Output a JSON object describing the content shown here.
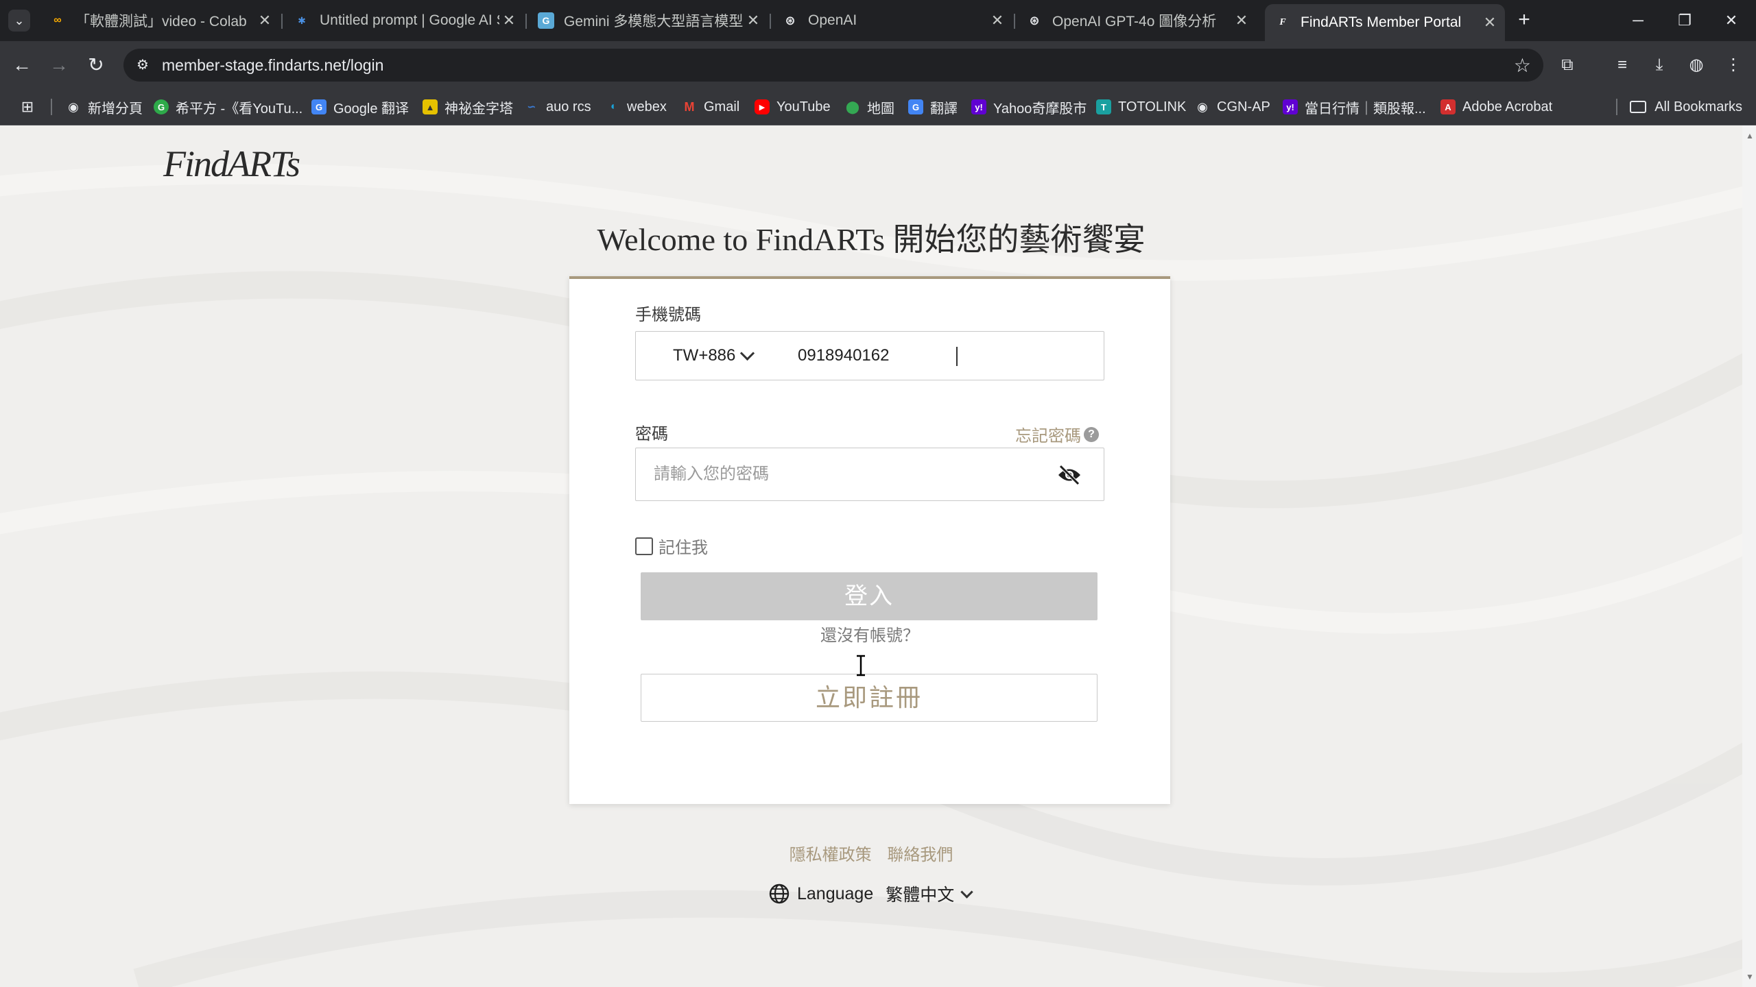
{
  "browser": {
    "tabs": [
      {
        "title": "「軟體測試」video - Colab",
        "icon": "colab-icon",
        "color": "#f9ab00"
      },
      {
        "title": "Untitled prompt | Google AI S",
        "icon": "google-ai-studio-icon",
        "color": "#4a90e2"
      },
      {
        "title": "Gemini 多模態大型語言模型大",
        "icon": "gemini-icon",
        "color": "#5aa9d6"
      },
      {
        "title": "OpenAI",
        "icon": "openai-icon",
        "color": "#ffffff"
      },
      {
        "title": "OpenAI GPT-4o 圖像分析",
        "icon": "openai-icon",
        "color": "#ffffff"
      },
      {
        "title": "FindARTs Member Portal",
        "icon": "findarts-icon",
        "color": "#ffffff",
        "active": true
      }
    ],
    "url": "member-stage.findarts.net/login",
    "bookmarks": [
      {
        "label": "新增分頁",
        "icon": "globe-icon",
        "color": "#5f6368"
      },
      {
        "label": "希平方 -《看YouTu...",
        "icon": "hope-english-icon",
        "color": "#2eaa4a"
      },
      {
        "label": "Google 翻译",
        "icon": "google-translate-icon",
        "color": "#4285f4"
      },
      {
        "label": "神祕金字塔",
        "icon": "pyramid-icon",
        "color": "#e5c100"
      },
      {
        "label": "auo rcs",
        "icon": "auo-icon",
        "color": "#3a7bd5"
      },
      {
        "label": "webex",
        "icon": "webex-icon",
        "color": "#1aa3d9"
      },
      {
        "label": "Gmail",
        "icon": "gmail-icon",
        "color": "#ea4335"
      },
      {
        "label": "YouTube",
        "icon": "youtube-icon",
        "color": "#ff0000"
      },
      {
        "label": "地圖",
        "icon": "maps-icon",
        "color": "#34a853"
      },
      {
        "label": "翻譯",
        "icon": "google-translate-icon",
        "color": "#4285f4"
      },
      {
        "label": "Yahoo奇摩股市",
        "icon": "yahoo-icon",
        "color": "#6001d2"
      },
      {
        "label": "TOTOLINK",
        "icon": "totolink-icon",
        "color": "#1aa0a0"
      },
      {
        "label": "CGN-AP",
        "icon": "globe-icon",
        "color": "#5f6368"
      },
      {
        "label": "當日行情｜類股報...",
        "icon": "yahoo-icon",
        "color": "#6001d2"
      },
      {
        "label": "Adobe Acrobat",
        "icon": "acrobat-icon",
        "color": "#d32f2f"
      }
    ],
    "all_bookmarks": "All Bookmarks"
  },
  "page": {
    "logo": "FindARTs",
    "welcome": "Welcome to FindARTs 開始您的藝術饗宴",
    "form": {
      "phone_label": "手機號碼",
      "country_code": "TW+886",
      "phone_value": "0918940162",
      "password_label": "密碼",
      "forgot_password": "忘記密碼",
      "password_placeholder": "請輸入您的密碼",
      "remember_me": "記住我",
      "login_button": "登入",
      "no_account": "還沒有帳號？",
      "register_button": "立即註冊"
    },
    "footer": {
      "privacy": "隱私權政策",
      "contact": "聯絡我們",
      "language_label": "Language",
      "language_value": "繁體中文"
    }
  },
  "colors": {
    "accent": "#a8997e",
    "button_disabled": "#c9c9c9",
    "chrome_dark": "#202124",
    "chrome": "#35363a"
  }
}
